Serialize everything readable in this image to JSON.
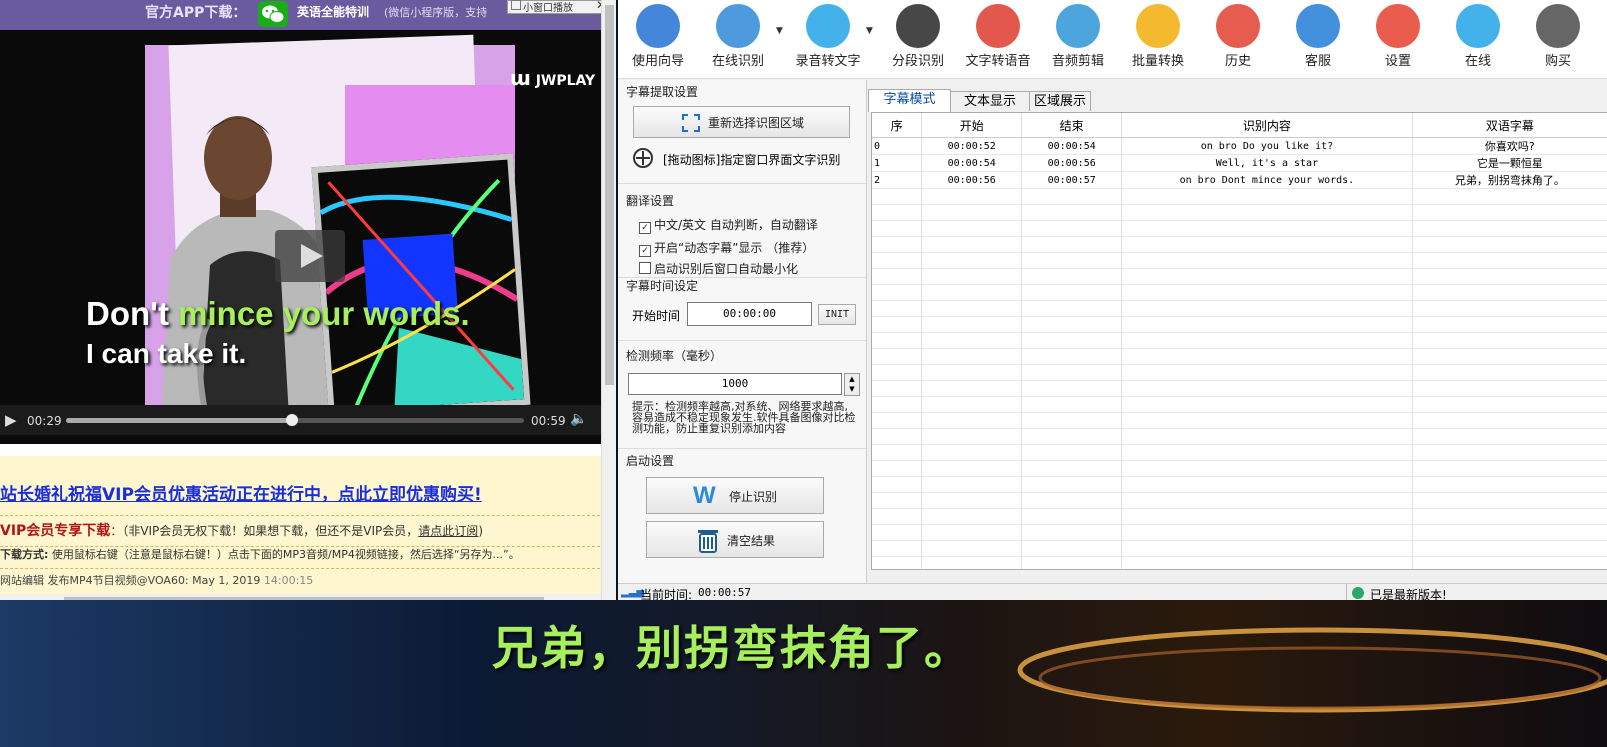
{
  "browser": {
    "banner": {
      "title": "官方APP下载：",
      "app_name": "英语全能特训",
      "note": "(微信小程序版，支持"
    },
    "mini_window_label": "小窗口播放",
    "video": {
      "watermark": "JWPLAY",
      "subtitle_line1_a": "Don't ",
      "subtitle_line1_b": "mince your words.",
      "subtitle_line2": "I can take it.",
      "current_time": "00:29",
      "duration": "00:59",
      "progress": 0.5
    },
    "promo_link": "站长婚礼祝福VIP会员优惠活动正在进行中，点此立即优惠购买!",
    "vip_title": "VIP会员专享下载",
    "vip_note": "：（非VIP会员无权下载！如果想下载，但还不是VIP会员，",
    "vip_link": "请点此订阅",
    "vip_close": ")",
    "download_label": "下载方式:",
    "download_text": "使用鼠标右键（注意是鼠标右键！）点击下面的MP3音频/MP4视频链接，然后选择“另存为...”。",
    "footer": "网站编辑 发布MP4节目视频@VOA60: May 1, 2019",
    "footer_time": "14:00:15"
  },
  "app": {
    "toolbar": [
      {
        "label": "使用向导",
        "icon": "navigation-arrow-icon",
        "color": "#2f79d6"
      },
      {
        "label": "在线识别",
        "icon": "microphone-icon",
        "color": "#3a8fd9"
      },
      {
        "label": "录音转文字",
        "icon": "w-logo-icon",
        "color": "#2fa8e8"
      },
      {
        "label": "分段识别",
        "icon": "waveform-icon",
        "color": "#333333"
      },
      {
        "label": "文字转语音",
        "icon": "megaphone-icon",
        "color": "#e0463a"
      },
      {
        "label": "音频剪辑",
        "icon": "scissors-icon",
        "color": "#3a9bd9"
      },
      {
        "label": "批量转换",
        "icon": "folder-icon",
        "color": "#f2b21a"
      },
      {
        "label": "历史",
        "icon": "history-icon",
        "color": "#e34b3c"
      },
      {
        "label": "客服",
        "icon": "help-icon",
        "color": "#2f84d9"
      },
      {
        "label": "设置",
        "icon": "lifebuoy-icon",
        "color": "#e84a3a"
      },
      {
        "label": "在线",
        "icon": "user-icon",
        "color": "#2fa8e8"
      },
      {
        "label": "购买",
        "icon": "cart-icon",
        "color": "#555555"
      }
    ],
    "subtitle_extract": {
      "title": "字幕提取设置",
      "reselect_button": "重新选择识图区域",
      "drag_hint": "[拖动图标]指定窗口界面文字识别"
    },
    "translate": {
      "title": "翻译设置",
      "auto_translate": "中文/英文 自动判断，自动翻译",
      "dynamic_sub": "开启“动态字幕”显示  （推荐）",
      "minimize": "启动识别后窗口自动最小化"
    },
    "time_setting": {
      "title": "字幕时间设定",
      "start_label": "开始时间",
      "start_value": "00:00:00",
      "init_button": "INIT"
    },
    "frequency": {
      "title": "检测频率（毫秒）",
      "value": "1000",
      "hint": "提示：检测频率越高,对系统、网络要求越高,容易造成不稳定现象发生.软件具备图像对比检测功能，防止重复识别添加内容"
    },
    "startup": {
      "title": "启动设置",
      "stop_button": "停止识别",
      "clear_button": "清空结果"
    },
    "tabs": [
      "字幕模式",
      "文本显示",
      "区域展示"
    ],
    "table": {
      "headers": [
        "序",
        "开始",
        "结束",
        "识别内容",
        "双语字幕"
      ],
      "rows": [
        [
          "0",
          "00:00:52",
          "00:00:54",
          "on bro Do you like it?",
          "你喜欢吗?"
        ],
        [
          "1",
          "00:00:54",
          "00:00:56",
          "Well, it's a star",
          "它是一颗恒星"
        ],
        [
          "2",
          "00:00:56",
          "00:00:57",
          "on bro Dont mince your words.",
          "兄弟，别拐弯抹角了。"
        ]
      ]
    },
    "status": {
      "current_time_label": "当前时间:",
      "current_time": "00:00:57",
      "version": "已是最新版本!"
    }
  },
  "overlay_subtitle": "兄弟，别拐弯抹角了。"
}
